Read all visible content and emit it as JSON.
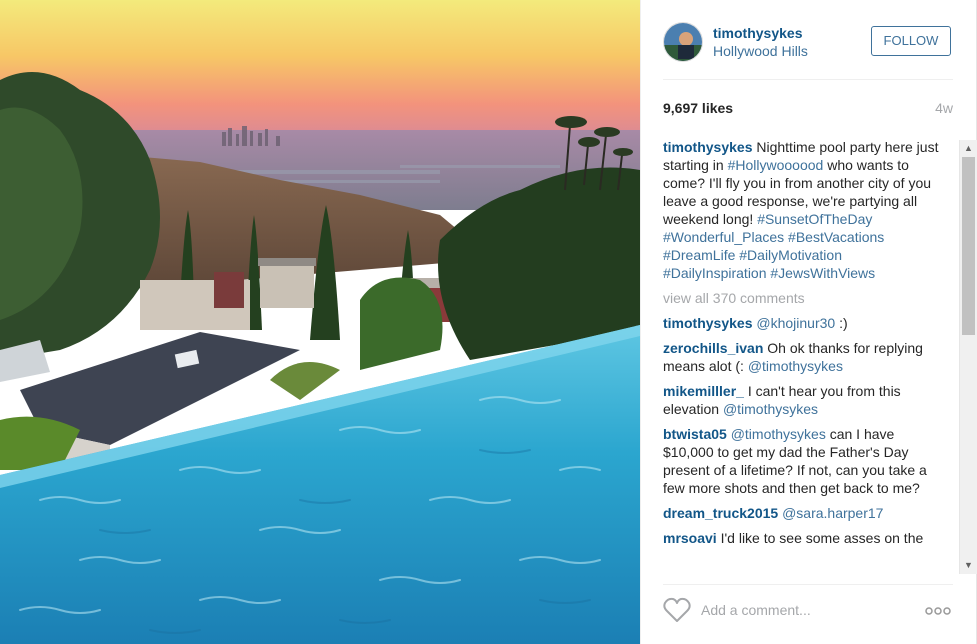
{
  "post": {
    "username": "timothysykes",
    "location": "Hollywood Hills",
    "follow_label": "FOLLOW",
    "likes": "9,697 likes",
    "time": "4w",
    "caption_prefix": "Nighttime pool party here just starting in ",
    "caption_tag1": "#Hollywoooood",
    "caption_mid": " who wants to come? I'll fly you in from another city of you leave a good response, we're partying all weekend long! ",
    "caption_tags": [
      "#SunsetOfTheDay",
      "#Wonderful_Places",
      "#BestVacations",
      "#DreamLife",
      "#DailyMotivation",
      "#DailyInspiration",
      "#JewsWithViews"
    ],
    "view_all": "view all 370 comments"
  },
  "comments": [
    {
      "user": "timothysykes",
      "text": "",
      "mention": "@khojinur30",
      "after": " :)"
    },
    {
      "user": "zerochills_ivan",
      "text": "Oh ok thanks for replying means alot (: ",
      "mention": "@timothysykes",
      "after": ""
    },
    {
      "user": "mikemilller_",
      "text": " I can't hear you from this elevation ",
      "mention": "@timothysykes",
      "after": ""
    },
    {
      "user": "btwista05",
      "text": "",
      "mention": "@timothysykes",
      "after": " can I have $10,000 to get my dad the Father's Day present of a lifetime? If not, can you take a few more shots and then get back to me?"
    },
    {
      "user": "dream_truck2015",
      "text": "",
      "mention": "@sara.harper17",
      "after": ""
    },
    {
      "user": "mrsoavi",
      "text": "I'd like to see some asses on the",
      "mention": "",
      "after": ""
    }
  ],
  "footer": {
    "comment_placeholder": "Add a comment...",
    "more_label": "ooo",
    "like_icon": "heart-icon",
    "more_icon": "more-options-icon"
  },
  "colors": {
    "username": "#125688",
    "link": "#3f729b",
    "muted": "#a5a7aa",
    "pool": "#2aa6cf",
    "sky_top": "#f5e070",
    "sky_bottom": "#f08a7a"
  }
}
